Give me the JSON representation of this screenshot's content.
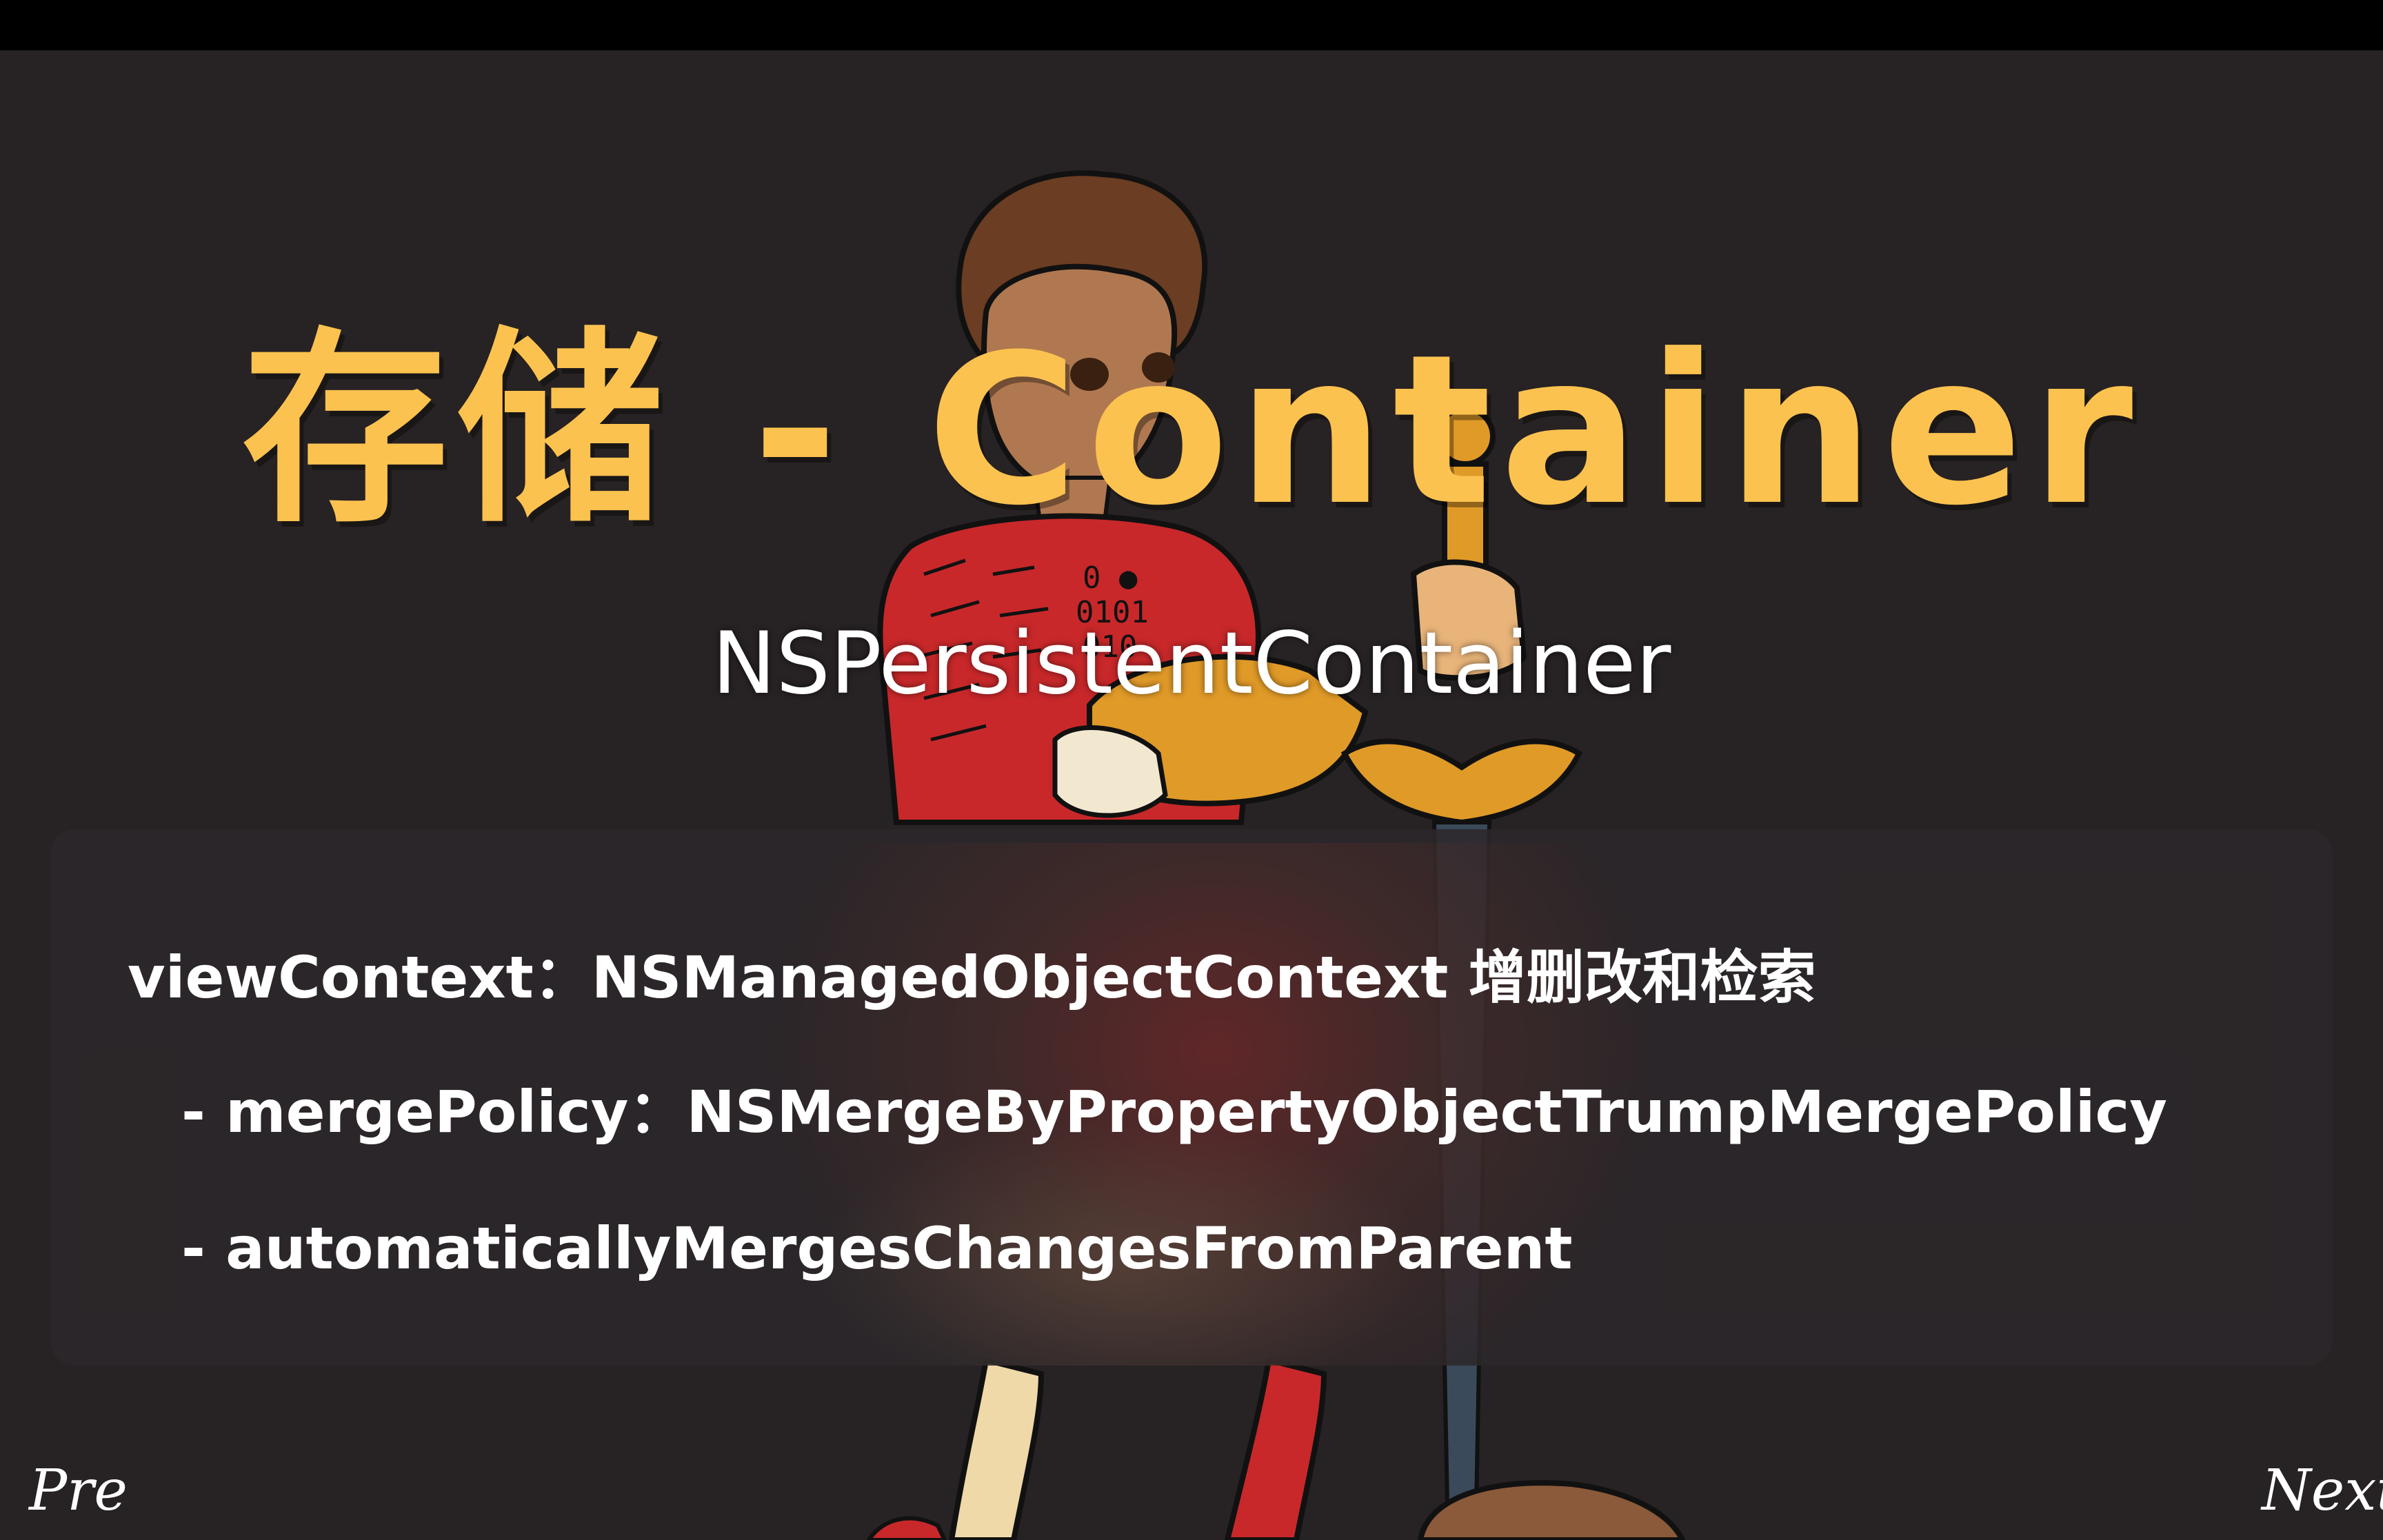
{
  "slide": {
    "title": "存储 - Container",
    "subtitle": "NSPersistentContainer",
    "lines": [
      "viewContext：NSManagedObjectContext 增删改和检索",
      "- mergePolicy：NSMergeByPropertyObjectTrumpMergePolicy",
      "- automaticallyMergesChangesFromParent"
    ]
  },
  "navigation": {
    "prev_label": "Pre",
    "next_label": "Next"
  },
  "colors": {
    "background": "#272223",
    "title": "#fcc24f",
    "text": "#ffffff",
    "panel": "#2c282a"
  }
}
